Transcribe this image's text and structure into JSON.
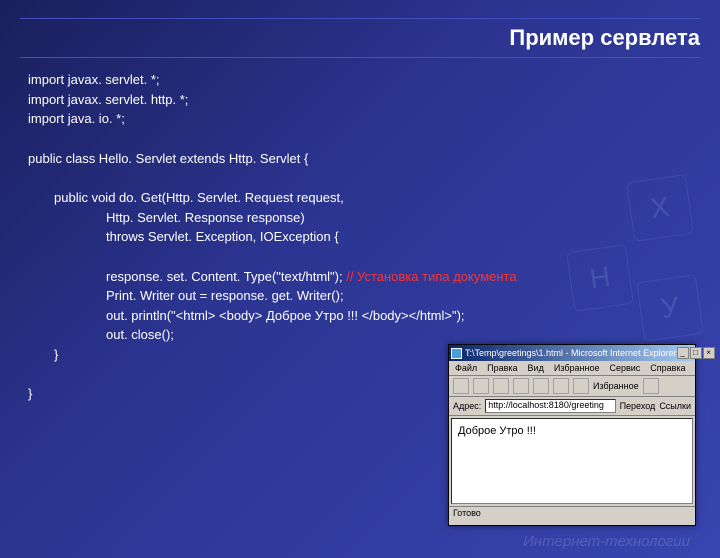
{
  "title": "Пример сервлета",
  "code": {
    "l1": "import javax. servlet. *;",
    "l2": "import javax. servlet. http. *;",
    "l3": "import java. io. *;",
    "l4": "public class Hello. Servlet extends Http. Servlet {",
    "l5": "public void do. Get(Http. Servlet. Request request,",
    "l6": "Http. Servlet. Response response)",
    "l7": "throws Servlet. Exception, IOException {",
    "l8a": "response. set. Content. Type(\"text/html\"); ",
    "l8b": "// Установка типа документа",
    "l9": "Print. Writer out = response. get. Writer();",
    "l10": "out. println(\"<html> <body> Доброе Утро !!! </body></html>\");",
    "l11": "out. close();",
    "l12": "}",
    "l13": "}"
  },
  "browser": {
    "title": "T:\\Temp\\greetings\\1.html - Microsoft Internet Explorer",
    "menu": {
      "m1": "Файл",
      "m2": "Правка",
      "m3": "Вид",
      "m4": "Избранное",
      "m5": "Сервис",
      "m6": "Справка"
    },
    "toolbar": {
      "fav": "Избранное"
    },
    "addr": {
      "label": "Адрес:",
      "value": "http://localhost:8180/greeting",
      "go": "Переход",
      "links": "Ссылки"
    },
    "content": "Доброе Утро !!!",
    "status": "Готово"
  },
  "footer": "Интернет-технологии",
  "keys": {
    "k1": "X",
    "k2": "Н",
    "k3": "У"
  }
}
